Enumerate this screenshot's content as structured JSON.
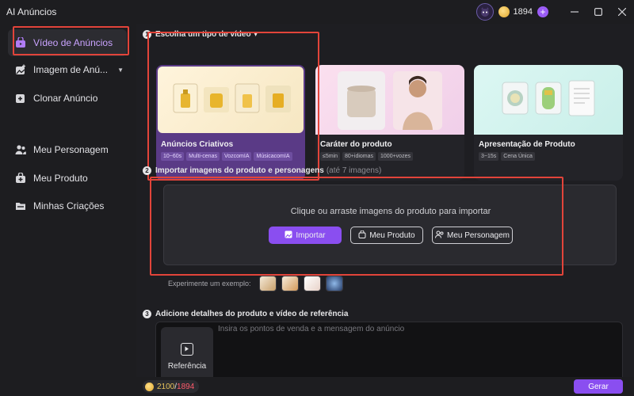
{
  "window": {
    "title": "AI Anúncios",
    "credits": "1894"
  },
  "sidebar": {
    "items": [
      {
        "label": "Vídeo de Anúncios",
        "icon": "ad-video-icon",
        "active": true
      },
      {
        "label": "Imagem de Anú...",
        "icon": "image-add-icon"
      },
      {
        "label": "Clonar Anúncio",
        "icon": "clone-icon"
      },
      {
        "label": "Meu Personagem",
        "icon": "person-icon"
      },
      {
        "label": "Meu Produto",
        "icon": "product-icon"
      },
      {
        "label": "Minhas Criações",
        "icon": "folder-icon"
      }
    ]
  },
  "step1": {
    "number": "1",
    "title": "Escolha um tipo de vídeo",
    "cards": [
      {
        "title": "Anúncios Criativos",
        "tags": [
          "10~60s",
          "Multi-cenas",
          "VozcomIA",
          "MúsicacomIA"
        ],
        "selected": true
      },
      {
        "title": "Caráter do produto",
        "tags": [
          "≤5min",
          "80+idiomas",
          "1000+vozes"
        ]
      },
      {
        "title": "Apresentação de Produto",
        "tags": [
          "3~15s",
          "Cena Única"
        ]
      }
    ]
  },
  "step2": {
    "number": "2",
    "title": "Importar imagens do produto e personagens",
    "hint": "(até 7 imagens)",
    "dropzone_text": "Clique ou arraste imagens do produto para importar",
    "buttons": {
      "import": "Importar",
      "my_product": "Meu Produto",
      "my_character": "Meu Personagem"
    },
    "example_label": "Experimente um exemplo:"
  },
  "step3": {
    "number": "3",
    "title": "Adicione detalhes do produto e vídeo de referência",
    "placeholder": "Insira os pontos de venda e a mensagem do anúncio",
    "reference_label": "Referência"
  },
  "footer": {
    "used": "2100",
    "separator": "/",
    "total": "1894",
    "generate": "Gerar"
  },
  "colors": {
    "accent": "#8a4ef0",
    "active_text": "#c9a3ff",
    "highlight": "#e2443a"
  }
}
